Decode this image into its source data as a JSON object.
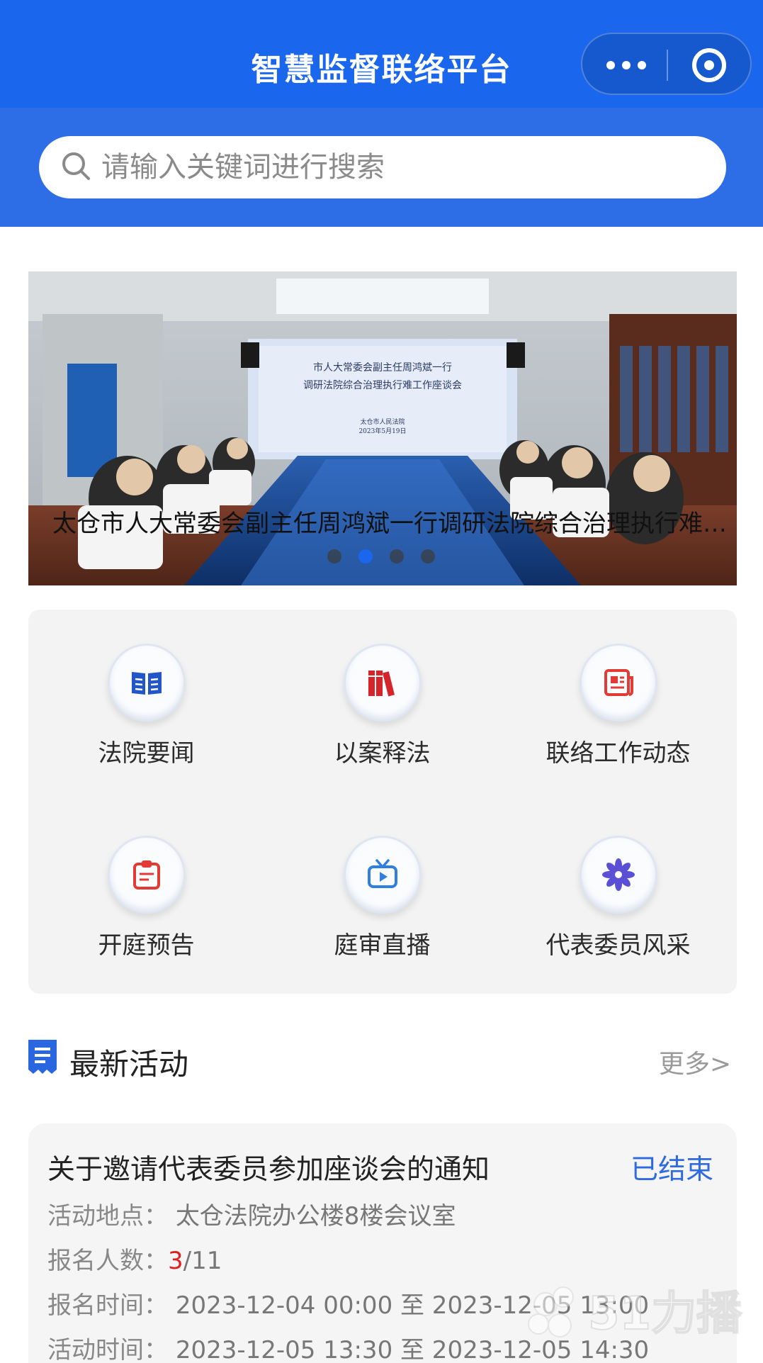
{
  "header": {
    "title": "智慧监督联络平台",
    "more_icon": "more-dots-icon",
    "close_icon": "target-icon"
  },
  "search": {
    "placeholder": "请输入关键词进行搜索"
  },
  "banner": {
    "caption": "太仓市人大常委会副主任周鸿斌一行调研法院综合治理执行难工作座谈会",
    "screen_line1": "市人大常委会副主任周鸿斌一行",
    "screen_line2": "调研法院综合治理执行难工作座谈会",
    "screen_line3": "太仓市人民法院",
    "screen_line4": "2023年5月19日",
    "slide_count": 4,
    "active_slide": 2
  },
  "grid": {
    "items": [
      {
        "label": "法院要闻",
        "icon": "book-icon"
      },
      {
        "label": "以案释法",
        "icon": "books-icon"
      },
      {
        "label": "联络工作动态",
        "icon": "newspaper-icon"
      },
      {
        "label": "开庭预告",
        "icon": "clipboard-icon"
      },
      {
        "label": "庭审直播",
        "icon": "tv-play-icon"
      },
      {
        "label": "代表委员风采",
        "icon": "flower-icon"
      }
    ]
  },
  "section": {
    "title": "最新活动",
    "more": "更多>"
  },
  "activity": {
    "title": "关于邀请代表委员参加座谈会的通知",
    "status": "已结束",
    "location_label": "活动地点：",
    "location": "太仓法院办公楼8楼会议室",
    "count_label": "报名人数：",
    "count_current": "3",
    "count_total": "/11",
    "signup_label": "报名时间：",
    "signup_time": "2023-12-04 00:00 至 2023-12-05 13:00",
    "event_label": "活动时间：",
    "event_time": "2023-12-05 13:30 至 2023-12-05 14:30"
  },
  "watermark": {
    "text": "51力播"
  },
  "colors": {
    "primary": "#1a66ec",
    "status_blue": "#2f6ae0",
    "highlight_red": "#e02020"
  }
}
